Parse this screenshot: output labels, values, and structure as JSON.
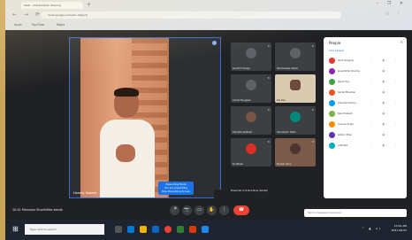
{
  "browser": {
    "tab_title": "Meet - Presentation Sharing",
    "new_tab": "+",
    "window_controls": "– ❐ ✕",
    "nav": "← → ⟳",
    "address": "meet.google.com/abc-defg-hij",
    "extensions": "☆ ⋮",
    "bookmarks": [
      "Apps",
      "YouTube",
      "Maps"
    ]
  },
  "meet": {
    "speaker_name": "Hamdy Sadeek",
    "presenting_line1": "Presenting Mode",
    "presenting_line2": "You are presenting",
    "presenting_line3": "Stop Presenting Screen",
    "presenter_label": "Presenter is Online Now (Adobe)",
    "tiles": [
      {
        "name": "Jarehmil Ahaga",
        "mic": "✕"
      },
      {
        "name": "Shamsdeep Kalam",
        "mic": "✕"
      },
      {
        "name": "Ashish Naughan",
        "mic": "✕"
      },
      {
        "name": "Ria Rao",
        "mic": "✕"
      },
      {
        "name": "Handkie Sadhedi",
        "mic": "✕"
      },
      {
        "name": "Sarvadami Daha",
        "mic": "✕"
      },
      {
        "name": "DJ Aftaab",
        "mic": "✕"
      },
      {
        "name": "Manish Saini",
        "mic": "✕"
      }
    ],
    "people_title": "People",
    "people_close": "✕",
    "add_people": "Add people",
    "participants": [
      "Sunil Ganguly",
      "Jayeshbhai Sharma",
      "Sarah Puri",
      "Kamal Bhushan",
      "Chandan Kumar",
      "Ravi Prakash",
      "Ananya Singh",
      "Gafoor Khan",
      "Aditi Rao"
    ],
    "participant_icons": "⋮ ● ⋮",
    "meeting_info": "10:41   Monsoon Shorthfiles  abcde",
    "chat_placeholder": "Send a message to everyone",
    "controls": [
      "🎤",
      "📷",
      "▭",
      "✋",
      "⋮"
    ],
    "end_call": "☎"
  },
  "taskbar": {
    "start": "⊞",
    "search_placeholder": "Type here to search",
    "tray": "^ ▲ ◂)",
    "time": "10:41 AM",
    "date": "2021-08-01"
  },
  "colors": {
    "accent": "#1a73e8",
    "end_call": "#ea4335"
  }
}
